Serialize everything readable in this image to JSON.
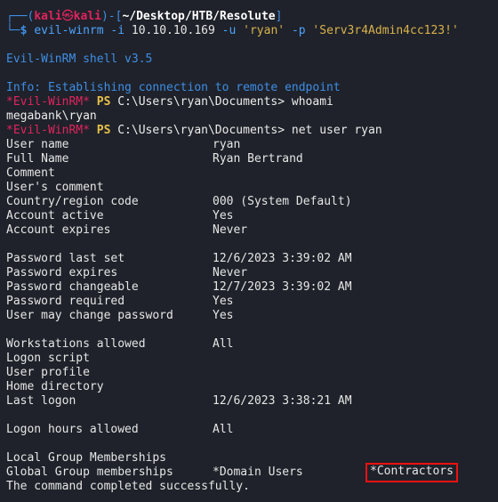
{
  "prompt": {
    "corner_top": "┌──(",
    "user": "kali",
    "at": "㉿",
    "host": "kali",
    "sep": ")-[",
    "path": "~/Desktop/HTB/Resolute",
    "close": "]",
    "corner_bottom": "└─",
    "dollar": "$",
    "cmd": "evil-winrm",
    "flag_i": "-i",
    "ip": "10.10.10.169",
    "flag_u": "-u",
    "user_arg": "'ryan'",
    "flag_p": "-p",
    "pass_arg": "'Serv3r4Admin4cc123!'"
  },
  "banner": "Evil-WinRM shell v3.5",
  "info": "Info: Establishing connection to remote endpoint",
  "ps_prompt": {
    "tag": "*Evil-WinRM*",
    "ps": "PS",
    "path": "C:\\Users\\ryan\\Documents>"
  },
  "cmd1": "whoami",
  "whoami_out": "megabank\\ryan",
  "cmd2": "net user ryan",
  "rows": [
    {
      "label": "User name",
      "value": "ryan"
    },
    {
      "label": "Full Name",
      "value": "Ryan Bertrand"
    },
    {
      "label": "Comment",
      "value": ""
    },
    {
      "label": "User's comment",
      "value": ""
    },
    {
      "label": "Country/region code",
      "value": "000 (System Default)"
    },
    {
      "label": "Account active",
      "value": "Yes"
    },
    {
      "label": "Account expires",
      "value": "Never"
    },
    {
      "label": "Password last set",
      "value": "12/6/2023 3:39:02 AM"
    },
    {
      "label": "Password expires",
      "value": "Never"
    },
    {
      "label": "Password changeable",
      "value": "12/7/2023 3:39:02 AM"
    },
    {
      "label": "Password required",
      "value": "Yes"
    },
    {
      "label": "User may change password",
      "value": "Yes"
    },
    {
      "label": "Workstations allowed",
      "value": "All"
    },
    {
      "label": "Logon script",
      "value": ""
    },
    {
      "label": "User profile",
      "value": ""
    },
    {
      "label": "Home directory",
      "value": ""
    },
    {
      "label": "Last logon",
      "value": "12/6/2023 3:38:21 AM"
    },
    {
      "label": "Logon hours allowed",
      "value": "All"
    },
    {
      "label": "Local Group Memberships",
      "value": ""
    },
    {
      "label": "Global Group memberships",
      "value": "*Domain Users"
    }
  ],
  "highlight_group": "*Contractors",
  "done": "The command completed successfully.",
  "colors": {
    "background": "#1f222a",
    "prompt_blue": "#3e8ee6",
    "evil_red": "#e0245e",
    "ps_yellow": "#e8c14a",
    "highlight_box": "#e11111"
  }
}
